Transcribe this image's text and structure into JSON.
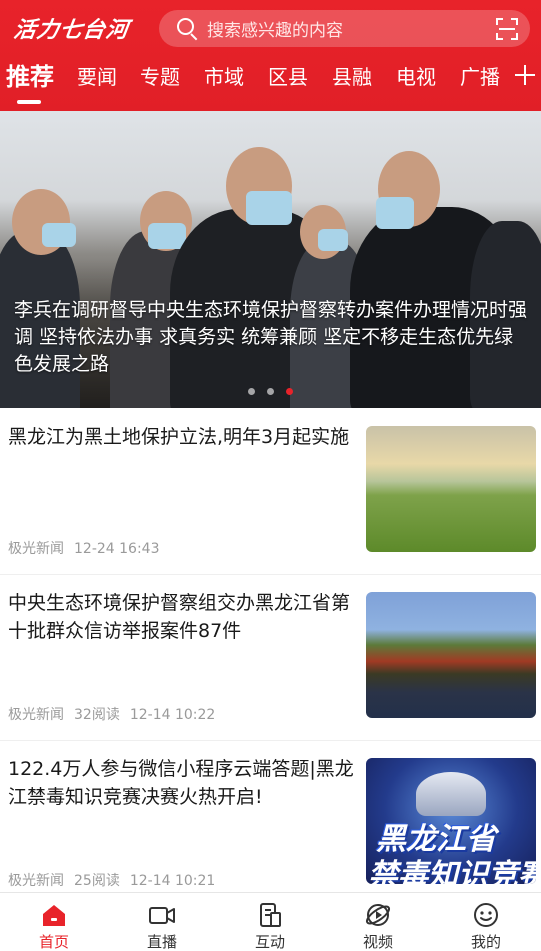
{
  "header": {
    "logo_text": "活力七台河",
    "search_placeholder": "搜索感兴趣的内容",
    "search_icon": "search-icon",
    "scan_icon": "scan-icon",
    "brand_color": "#e8232a"
  },
  "tabs": {
    "items": [
      "推荐",
      "要闻",
      "专题",
      "市域",
      "区县",
      "县融",
      "电视",
      "广播"
    ],
    "active": "推荐",
    "more_icon": "plus-icon"
  },
  "banner": {
    "caption": "李兵在调研督导中央生态环境保护督察转办案件办理情况时强调 坚持依法办事 求真务实 统筹兼顾 坚定不移走生态优先绿色发展之路",
    "page_count": 3,
    "active_page": 3
  },
  "news": [
    {
      "title": "黑龙江为黑土地保护立法,明年3月起实施",
      "source": "极光新闻",
      "reads": "",
      "time": "12-24 16:43"
    },
    {
      "title": "中央生态环境保护督察组交办黑龙江省第十批群众信访举报案件87件",
      "source": "极光新闻",
      "reads": "32阅读",
      "time": "12-14 10:22"
    },
    {
      "title": "122.4万人参与微信小程序云端答题|黑龙江禁毒知识竞赛决赛火热开启!",
      "source": "极光新闻",
      "reads": "25阅读",
      "time": "12-14 10:21",
      "thumb_text_1": "黑龙江省",
      "thumb_text_2": "禁毒知识竞赛"
    }
  ],
  "bottom_nav": {
    "items": [
      {
        "label": "首页",
        "icon": "home-icon",
        "active": true
      },
      {
        "label": "直播",
        "icon": "live-camera-icon",
        "active": false
      },
      {
        "label": "互动",
        "icon": "interaction-icon",
        "active": false
      },
      {
        "label": "视频",
        "icon": "video-icon",
        "active": false
      },
      {
        "label": "我的",
        "icon": "profile-icon",
        "active": false
      }
    ]
  }
}
